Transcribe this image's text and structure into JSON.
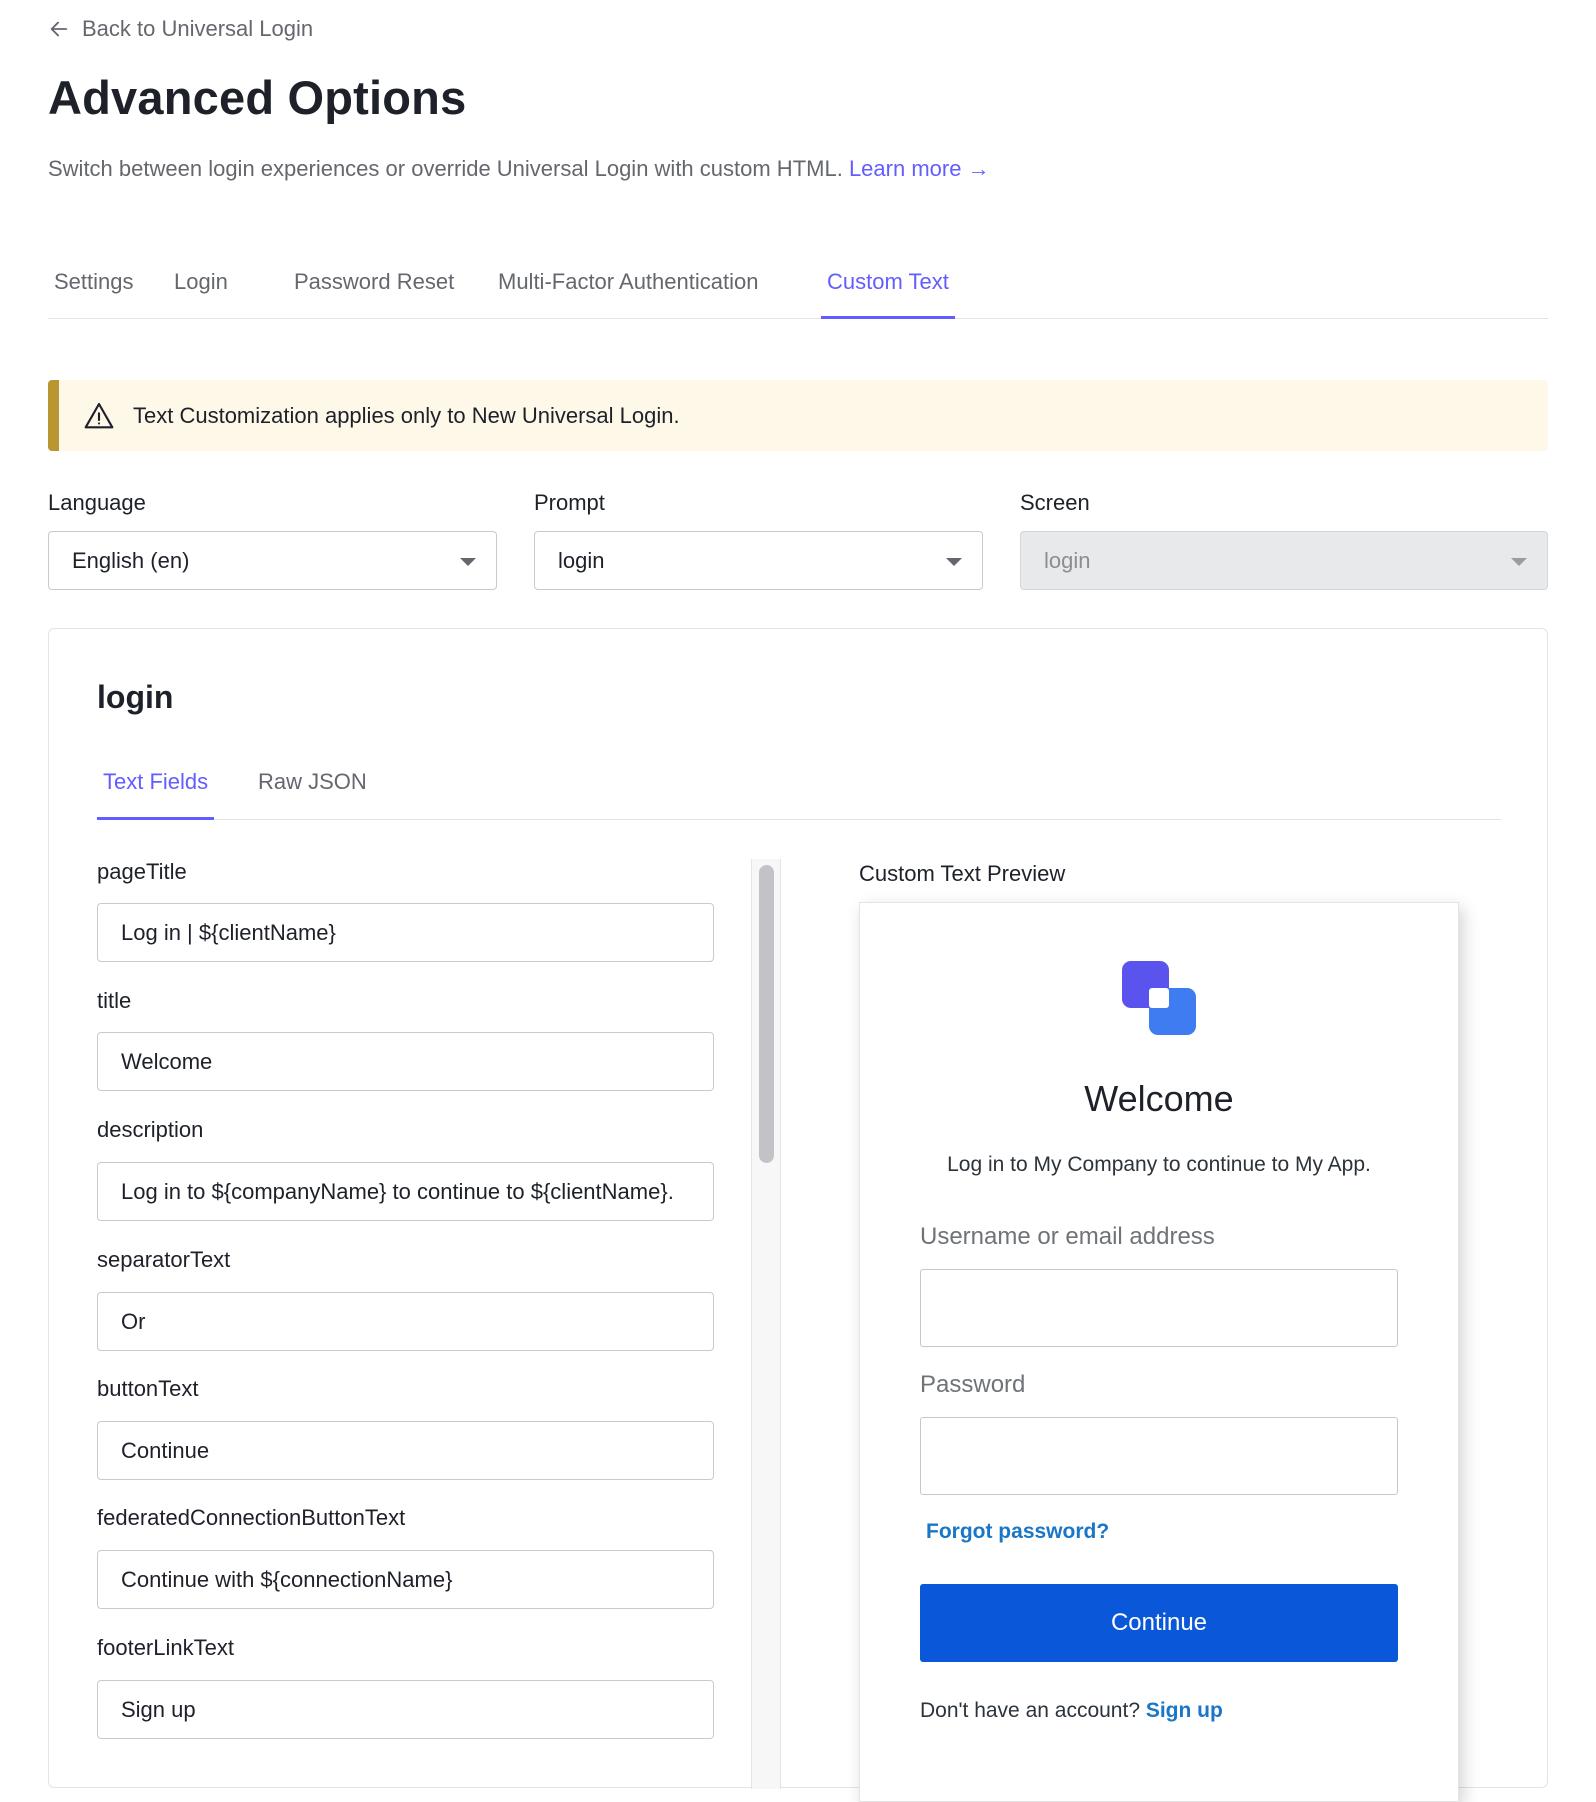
{
  "header": {
    "back_label": "Back to Universal Login",
    "title": "Advanced Options",
    "subtitle": "Switch between login experiences or override Universal Login with custom HTML.",
    "learn_more": "Learn more"
  },
  "tabs": [
    {
      "label": "Settings"
    },
    {
      "label": "Login"
    },
    {
      "label": "Password Reset"
    },
    {
      "label": "Multi-Factor Authentication"
    },
    {
      "label": "Custom Text",
      "active": true
    }
  ],
  "banner": {
    "text": "Text Customization applies only to New Universal Login."
  },
  "filters": {
    "language": {
      "label": "Language",
      "value": "English (en)"
    },
    "prompt": {
      "label": "Prompt",
      "value": "login"
    },
    "screen": {
      "label": "Screen",
      "value": "login"
    }
  },
  "card": {
    "title": "login",
    "subtabs": [
      {
        "label": "Text Fields",
        "active": true
      },
      {
        "label": "Raw JSON"
      }
    ],
    "fields": [
      {
        "name": "pageTitle",
        "value": "Log in | ${clientName}"
      },
      {
        "name": "title",
        "value": "Welcome"
      },
      {
        "name": "description",
        "value": "Log in to ${companyName} to continue to ${clientName}."
      },
      {
        "name": "separatorText",
        "value": "Or"
      },
      {
        "name": "buttonText",
        "value": "Continue"
      },
      {
        "name": "federatedConnectionButtonText",
        "value": "Continue with ${connectionName}"
      },
      {
        "name": "footerLinkText",
        "value": "Sign up"
      }
    ]
  },
  "preview": {
    "label": "Custom Text Preview",
    "title": "Welcome",
    "description": "Log in to My Company to continue to My App.",
    "username_label": "Username or email address",
    "password_label": "Password",
    "forgot": "Forgot password?",
    "button": "Continue",
    "footer_text": "Don't have an account?",
    "footer_link": "Sign up"
  },
  "colors": {
    "accent": "#635dff",
    "primary_button": "#0a57d9",
    "link": "#1a76c7",
    "warning_bar": "#b9962f",
    "warning_bg": "#fdf8e8"
  }
}
